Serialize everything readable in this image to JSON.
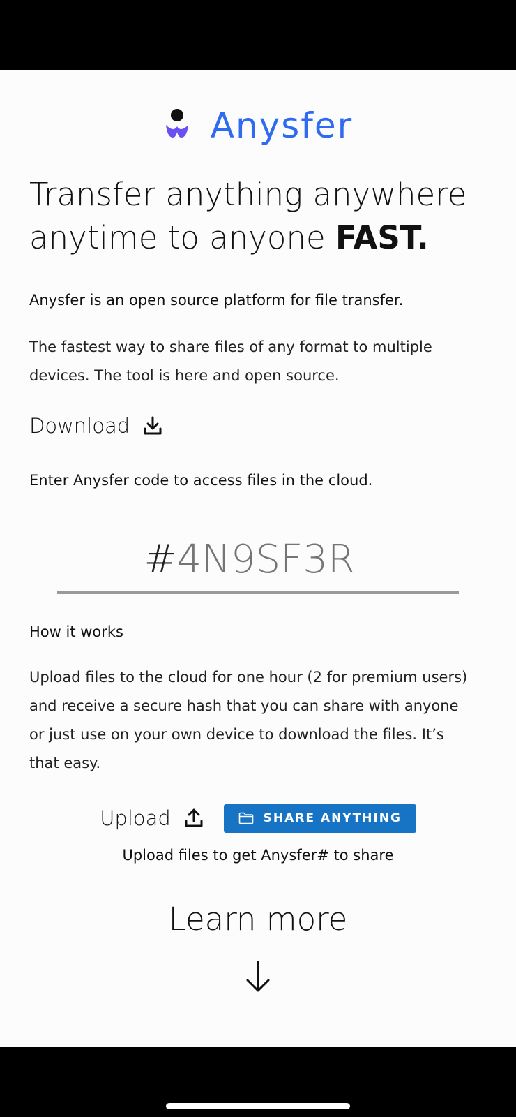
{
  "app": {
    "name": "Anysfer",
    "brand_color": "#2f6bf0"
  },
  "hero": {
    "headline_light": "Transfer anything anywhere anytime to anyone",
    "headline_bold": "FAST."
  },
  "intro": "Anysfer is an open source platform for file transfer.",
  "description": "The fastest way to share files of any format to multiple devices. The tool is here and open source.",
  "download": {
    "label": "Download",
    "icon": "download-icon"
  },
  "code_entry": {
    "prompt": "Enter Anysfer code to access files in the cloud.",
    "hash_symbol": "#",
    "placeholder": "4N9SF3R"
  },
  "how_it_works": {
    "title": "How it works",
    "body": "Upload files to the cloud for one hour (2 for premium users) and receive a secure hash that you can share with anyone or just use on your own device to download the files. It’s that easy."
  },
  "upload": {
    "label": "Upload",
    "icon": "upload-icon",
    "button_label": "SHARE ANYTHING",
    "button_icon": "folder-icon",
    "button_color": "#1774c4",
    "hint": "Upload files to get Anysfer# to share"
  },
  "learn_more": {
    "label": "Learn more",
    "icon": "arrow-down-icon"
  }
}
